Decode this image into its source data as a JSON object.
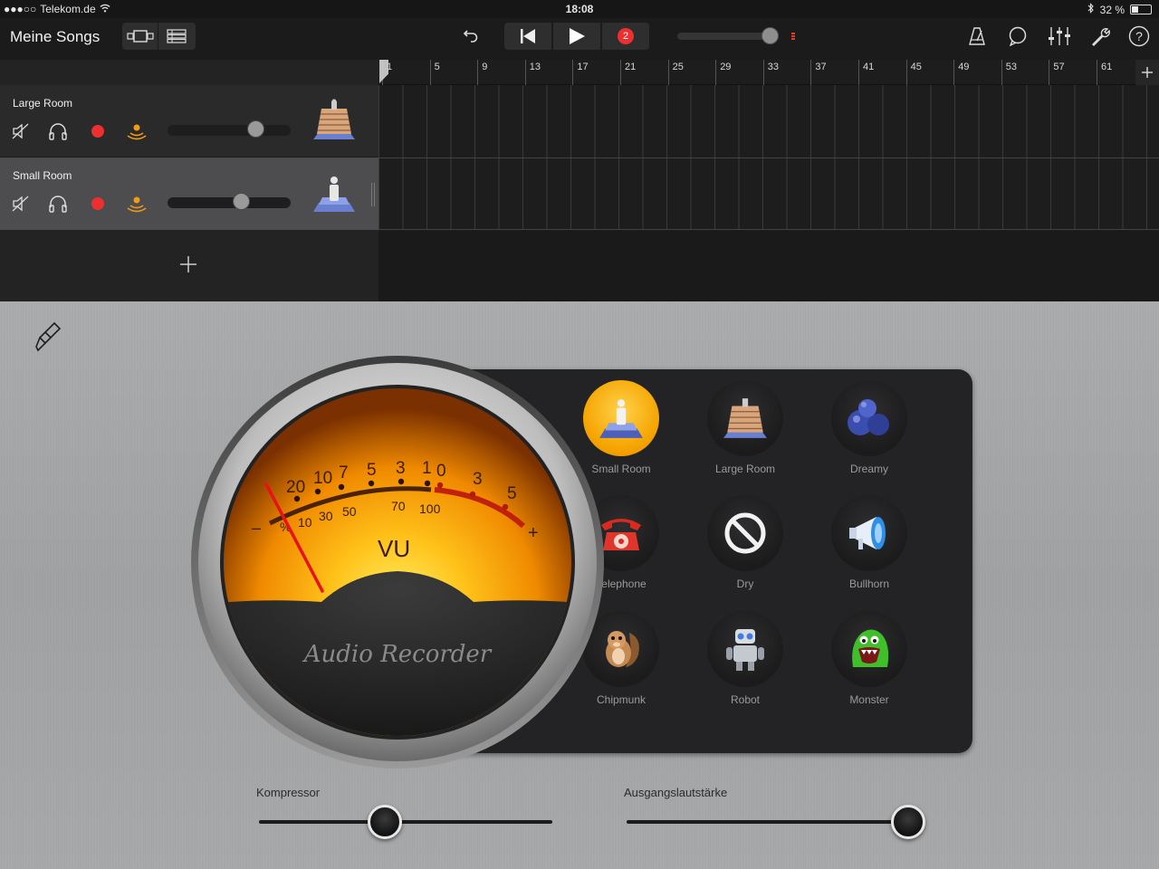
{
  "status": {
    "carrier": "Telekom.de",
    "time": "18:08",
    "battery": "32 %"
  },
  "toolbar": {
    "title": "Meine Songs",
    "record_count": "2"
  },
  "tracks": [
    {
      "name": "Large Room",
      "volume": 0.72
    },
    {
      "name": "Small Room",
      "volume": 0.6
    }
  ],
  "ruler": {
    "bars": [
      "1",
      "5",
      "9",
      "13",
      "17",
      "21",
      "25",
      "29",
      "33",
      "37",
      "41",
      "45",
      "49",
      "53",
      "57",
      "61"
    ]
  },
  "vu": {
    "title": "VU",
    "brand": "Audio Recorder",
    "scale_top": [
      "20",
      "10",
      "7",
      "5",
      "3",
      "1",
      "0",
      "3",
      "5"
    ],
    "scale_bottom": [
      "%",
      "10",
      "30",
      "50",
      "70",
      "100"
    ],
    "minus": "–",
    "plus": "+"
  },
  "presets": [
    {
      "label": "Small Room",
      "icon": "small-room-icon",
      "active": true
    },
    {
      "label": "Large Room",
      "icon": "large-room-icon",
      "active": false
    },
    {
      "label": "Dreamy",
      "icon": "dreamy-icon",
      "active": false
    },
    {
      "label": "Telephone",
      "icon": "telephone-icon",
      "active": false
    },
    {
      "label": "Dry",
      "icon": "dry-icon",
      "active": false
    },
    {
      "label": "Bullhorn",
      "icon": "bullhorn-icon",
      "active": false
    },
    {
      "label": "Chipmunk",
      "icon": "chipmunk-icon",
      "active": false
    },
    {
      "label": "Robot",
      "icon": "robot-icon",
      "active": false
    },
    {
      "label": "Monster",
      "icon": "monster-icon",
      "active": false
    }
  ],
  "sliders": {
    "compressor": {
      "label": "Kompressor",
      "value": 0.43
    },
    "output": {
      "label": "Ausgangslautstärke",
      "value": 0.96
    }
  },
  "colors": {
    "record": "#ee2f2f",
    "monitor": "#f09a1a",
    "active_preset": "#f5a400"
  }
}
